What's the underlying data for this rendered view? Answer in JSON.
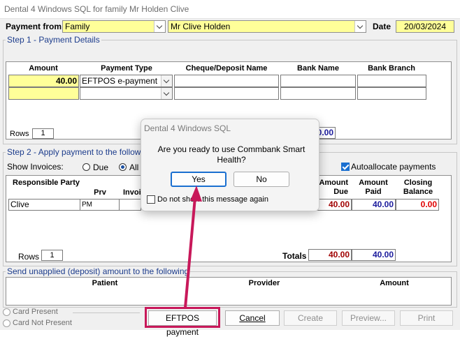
{
  "window": {
    "title": "Dental 4 Windows SQL for family Mr  Holden  Clive"
  },
  "header": {
    "payment_from_label": "Payment from",
    "payment_from_value": "Family",
    "payer_value": "Mr Clive  Holden",
    "date_label": "Date",
    "date_value": "20/03/2024"
  },
  "step1": {
    "title": "Step 1 - Payment Details",
    "columns": [
      "Amount",
      "Payment Type",
      "Cheque/Deposit Name",
      "Bank Name",
      "Bank Branch"
    ],
    "row1": {
      "amount": "40.00",
      "payment_type": "EFTPOS e-payment"
    },
    "rows_label": "Rows",
    "rows_value": "1",
    "total_partial": "0.00"
  },
  "step2": {
    "title": "Step 2 - Apply payment to the follow",
    "show_invoices_label": "Show Invoices:",
    "radio_due": "Due",
    "radio_all": "All",
    "autoallocate_label": "Autoallocate payments",
    "columns": {
      "responsible_party": "Responsible Party",
      "prv": "Prv",
      "invoice": "Invoi",
      "amount_due": "Amount Due",
      "amount_paid": "Amount Paid",
      "closing_balance": "Closing Balance"
    },
    "row": {
      "party": "Clive",
      "prv": "PM",
      "amount_due": "40.00",
      "amount_paid": "40.00",
      "closing_balance": "0.00"
    },
    "rows_label": "Rows",
    "rows_value": "1",
    "totals_label": "Totals",
    "totals_due": "40.00",
    "totals_paid": "40.00"
  },
  "unapplied": {
    "title": "Send unapplied (deposit) amount to the following",
    "columns": [
      "Patient",
      "Provider",
      "Amount"
    ]
  },
  "card": {
    "present": "Card Present",
    "not_present": "Card Not Present"
  },
  "buttons": {
    "eftpos": "EFTPOS payment",
    "cancel": "Cancel",
    "create": "Create",
    "preview": "Preview...",
    "print": "Print"
  },
  "dialog": {
    "title": "Dental 4 Windows SQL",
    "message": "Are you ready to use Commbank Smart Health?",
    "yes": "Yes",
    "no": "No",
    "checkbox_label": "Do not show this message again"
  },
  "annotation_color": "#c8185a"
}
